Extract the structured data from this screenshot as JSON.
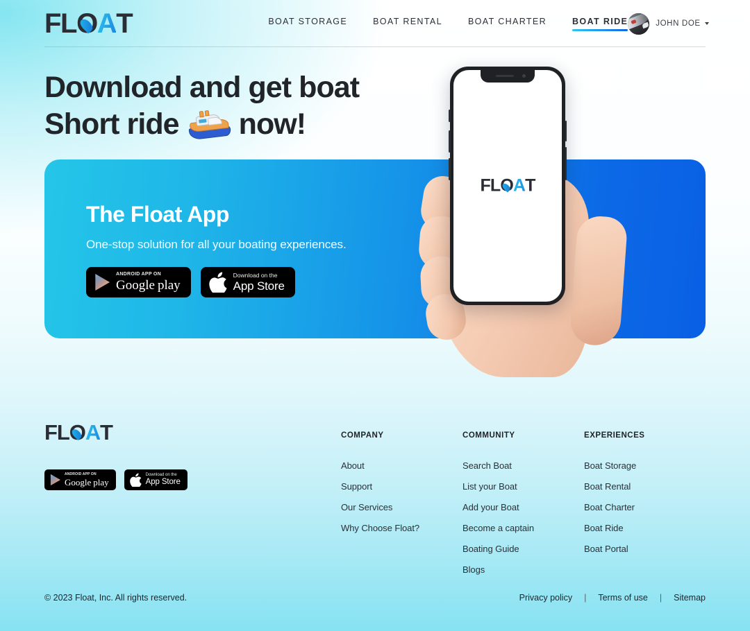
{
  "brand": {
    "logo_fl": "FL",
    "logo_o": "O",
    "logo_a": "A",
    "logo_t": "T",
    "logo_full": "FLOAT"
  },
  "colors": {
    "accent_cyan": "#24c6e8",
    "accent_blue": "#0a5fe4",
    "text_dark": "#212429",
    "page_bg_top": "#ffffff",
    "page_bg_bottom": "#86e2f2"
  },
  "header": {
    "nav": [
      {
        "label": "BOAT STORAGE",
        "active": false
      },
      {
        "label": "BOAT RENTAL",
        "active": false
      },
      {
        "label": "BOAT CHARTER",
        "active": false
      },
      {
        "label": "BOAT RIDE",
        "active": true
      }
    ],
    "user": {
      "name": "JOHN DOE",
      "avatar_icon": "user-avatar-photo",
      "caret_icon": "chevron-down-icon"
    }
  },
  "hero": {
    "line1": "Download and get boat",
    "line2_before": "Short ride",
    "emoji_name": "motorboat-emoji",
    "line2_after": "now!"
  },
  "visual": {
    "phone_screen_logo": "FLOAT",
    "hand_icon": "hand-holding-phone"
  },
  "cta": {
    "title": "The Float App",
    "subtitle": "One-stop solution for all your boating experiences.",
    "google_play": {
      "top": "ANDROID APP ON",
      "word1": "Google",
      "word2": "play",
      "icon": "google-play-icon"
    },
    "app_store": {
      "top": "Download on the",
      "bottom": "App Store",
      "icon": "apple-icon"
    }
  },
  "footer": {
    "columns": [
      {
        "title": "COMPANY",
        "links": [
          "About",
          "Support",
          "Our Services",
          "Why Choose Float?"
        ]
      },
      {
        "title": "COMMUNITY",
        "links": [
          "Search Boat",
          "List your Boat",
          "Add your Boat",
          "Become a captain",
          "Boating Guide",
          "Blogs"
        ]
      },
      {
        "title": "EXPERIENCES",
        "links": [
          "Boat Storage",
          "Boat Rental",
          "Boat Charter",
          "Boat Ride",
          "Boat Portal"
        ]
      }
    ],
    "copyright": "© 2023 Float, Inc. All rights reserved.",
    "legal": [
      "Privacy policy",
      "Terms of use",
      "Sitemap"
    ],
    "separator": "|"
  }
}
